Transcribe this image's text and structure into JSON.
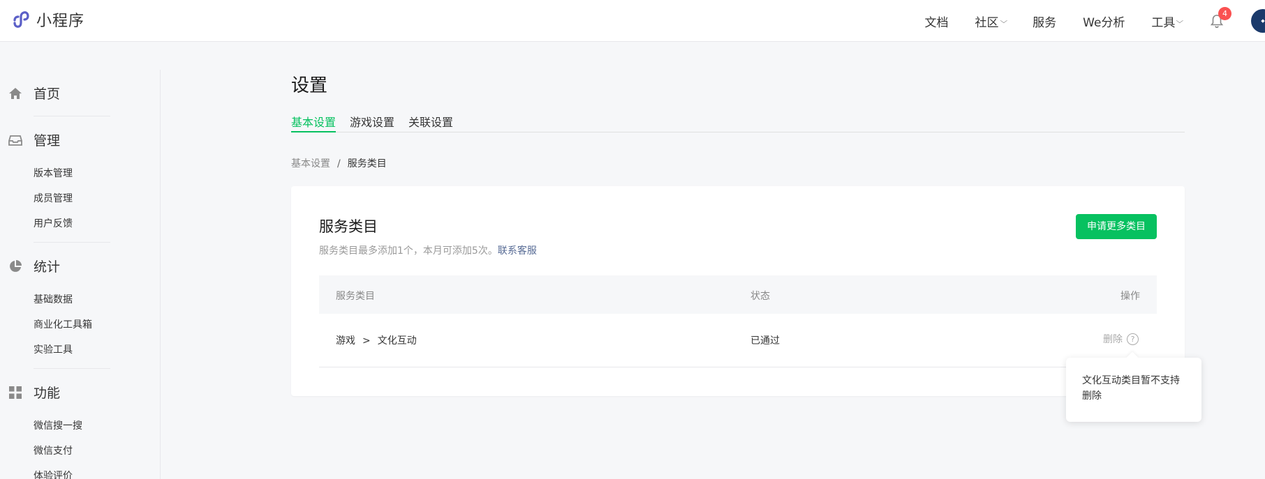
{
  "header": {
    "app_name": "小程序",
    "nav": [
      {
        "label": "文档",
        "dropdown": false
      },
      {
        "label": "社区",
        "dropdown": true
      },
      {
        "label": "服务",
        "dropdown": false
      },
      {
        "label": "We分析",
        "dropdown": false
      },
      {
        "label": "工具",
        "dropdown": true
      }
    ],
    "notification_count": "4",
    "avatar_icon": "user-avatar"
  },
  "sidebar": {
    "home": {
      "label": "首页",
      "icon": "home-icon"
    },
    "manage": {
      "label": "管理",
      "icon": "inbox-icon",
      "items": [
        "版本管理",
        "成员管理",
        "用户反馈"
      ]
    },
    "stats": {
      "label": "统计",
      "icon": "pie-chart-icon",
      "items": [
        "基础数据",
        "商业化工具箱",
        "实验工具"
      ]
    },
    "features": {
      "label": "功能",
      "icon": "grid-icon",
      "items": [
        "微信搜一搜",
        "微信支付",
        "体验评价"
      ]
    }
  },
  "main": {
    "title": "设置",
    "tabs": [
      {
        "label": "基本设置",
        "active": true
      },
      {
        "label": "游戏设置",
        "active": false
      },
      {
        "label": "关联设置",
        "active": false
      }
    ],
    "breadcrumb": {
      "parent": "基本设置",
      "separator": "/",
      "current": "服务类目"
    },
    "card": {
      "title": "服务类目",
      "desc_prefix": "服务类目最多添加1个，本月可添加5次。",
      "desc_link": "联系客服",
      "apply_button": "申请更多类目",
      "table": {
        "headers": [
          "服务类目",
          "状态",
          "操作"
        ],
        "rows": [
          {
            "category": "游戏",
            "arrow": ">",
            "subcategory": "文化互动",
            "status": "已通过",
            "action": "删除",
            "help": "?"
          }
        ]
      }
    },
    "tooltip": "文化互动类目暂不支持删除"
  },
  "colors": {
    "accent": "#07c160",
    "link": "#576b95",
    "badge": "#fa5151"
  }
}
